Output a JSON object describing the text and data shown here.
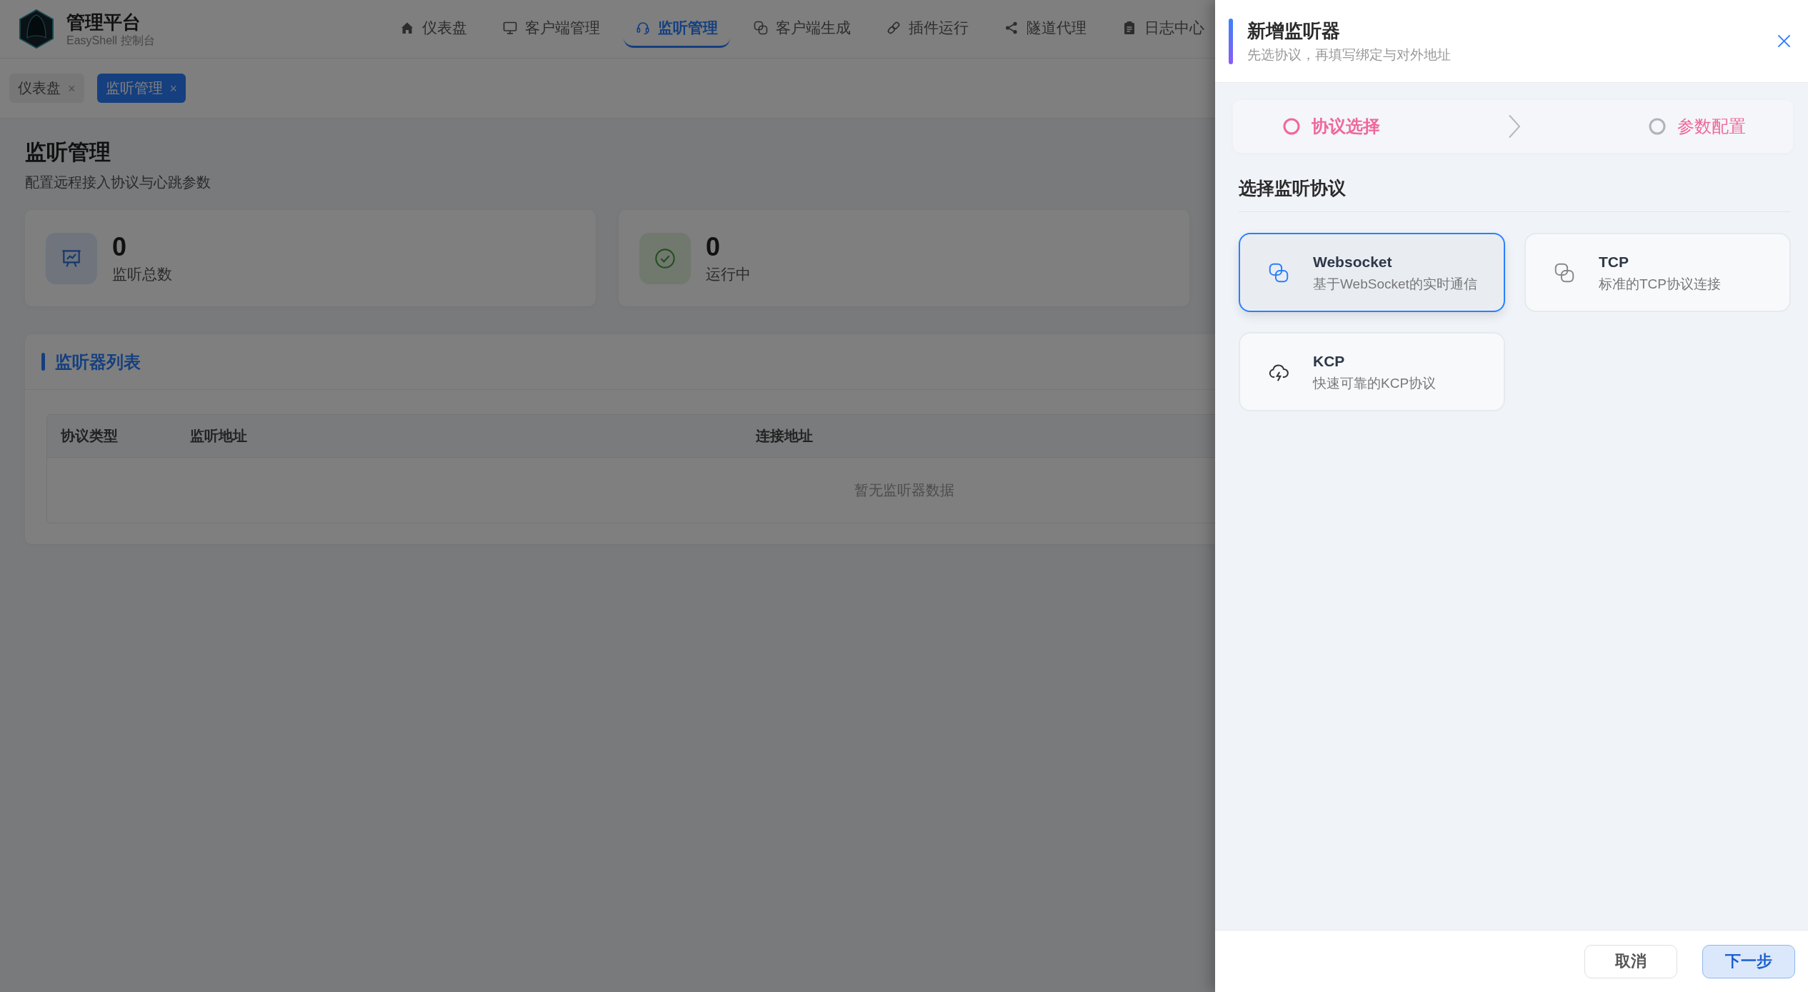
{
  "header": {
    "title": "管理平台",
    "subtitle": "EasyShell 控制台"
  },
  "nav": [
    {
      "label": "仪表盘",
      "selected": false
    },
    {
      "label": "客户端管理",
      "selected": false
    },
    {
      "label": "监听管理",
      "selected": true
    },
    {
      "label": "客户端生成",
      "selected": false
    },
    {
      "label": "插件运行",
      "selected": false
    },
    {
      "label": "隧道代理",
      "selected": false
    },
    {
      "label": "日志中心",
      "selected": false
    }
  ],
  "tabs": [
    {
      "label": "仪表盘",
      "close": "×",
      "selected": false
    },
    {
      "label": "监听管理",
      "close": "×",
      "selected": true
    }
  ],
  "page": {
    "title": "监听管理",
    "subtitle": "配置远程接入协议与心跳参数"
  },
  "stats": [
    {
      "value": "0",
      "label": "监听总数"
    },
    {
      "value": "0",
      "label": "运行中"
    }
  ],
  "listener_panel": {
    "title": "监听器列表",
    "table": {
      "columns": [
        "协议类型",
        "监听地址",
        "连接地址"
      ],
      "empty_text": "暂无监听器数据"
    }
  },
  "drawer": {
    "title": "新增监听器",
    "subtitle": "先选协议，再填写绑定与对外地址",
    "steps": [
      {
        "label": "协议选择",
        "active": true
      },
      {
        "label": "参数配置",
        "active": false
      }
    ],
    "section_title": "选择监听协议",
    "protocols": [
      {
        "name": "Websocket",
        "description": "基于WebSocket的实时通信",
        "selected": true
      },
      {
        "name": "TCP",
        "description": "标准的TCP协议连接",
        "selected": false
      },
      {
        "name": "KCP",
        "description": "快速可靠的KCP协议",
        "selected": false
      }
    ],
    "buttons": [
      {
        "label": "取消",
        "kind": "secondary"
      },
      {
        "label": "下一步",
        "kind": "primary"
      }
    ]
  }
}
